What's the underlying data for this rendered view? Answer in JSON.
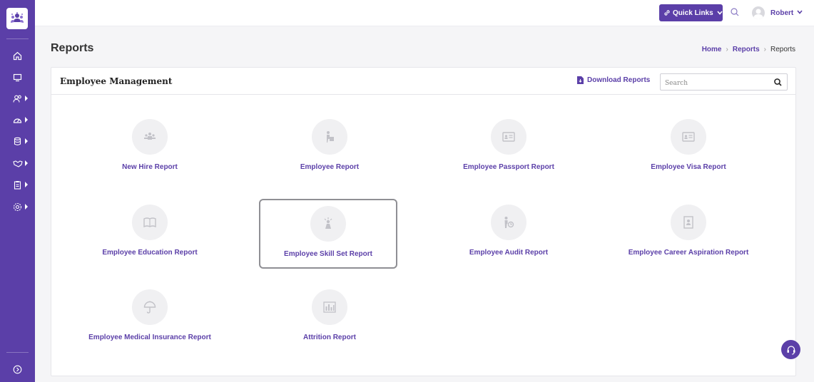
{
  "header": {
    "quick_links_label": "Quick Links",
    "user_name": "Robert"
  },
  "page": {
    "title": "Reports"
  },
  "breadcrumb": {
    "home": "Home",
    "reports": "Reports",
    "current": "Reports"
  },
  "card": {
    "title": "Employee Management",
    "download_label": "Download Reports",
    "search_placeholder": "Search"
  },
  "reports": [
    {
      "label": "New Hire Report",
      "icon": "new-hire-icon"
    },
    {
      "label": "Employee Report",
      "icon": "employee-icon"
    },
    {
      "label": "Employee Passport Report",
      "icon": "passport-icon"
    },
    {
      "label": "Employee Visa Report",
      "icon": "visa-icon"
    },
    {
      "label": "Employee Education Report",
      "icon": "book-icon"
    },
    {
      "label": "Employee Skill Set Report",
      "icon": "skill-icon"
    },
    {
      "label": "Employee Audit Report",
      "icon": "audit-icon"
    },
    {
      "label": "Employee Career Aspiration Report",
      "icon": "career-icon"
    },
    {
      "label": "Employee Medical Insurance Report",
      "icon": "umbrella-icon"
    },
    {
      "label": "Attrition Report",
      "icon": "bar-chart-icon"
    }
  ],
  "sidebar": {
    "items": [
      "home-icon",
      "monitor-icon",
      "users-icon",
      "dashboard-icon",
      "database-icon",
      "handshake-icon",
      "clipboard-icon",
      "settings-icon"
    ]
  },
  "colors": {
    "brand": "#5b3fa8",
    "icon_bg": "#f0f0f2"
  }
}
